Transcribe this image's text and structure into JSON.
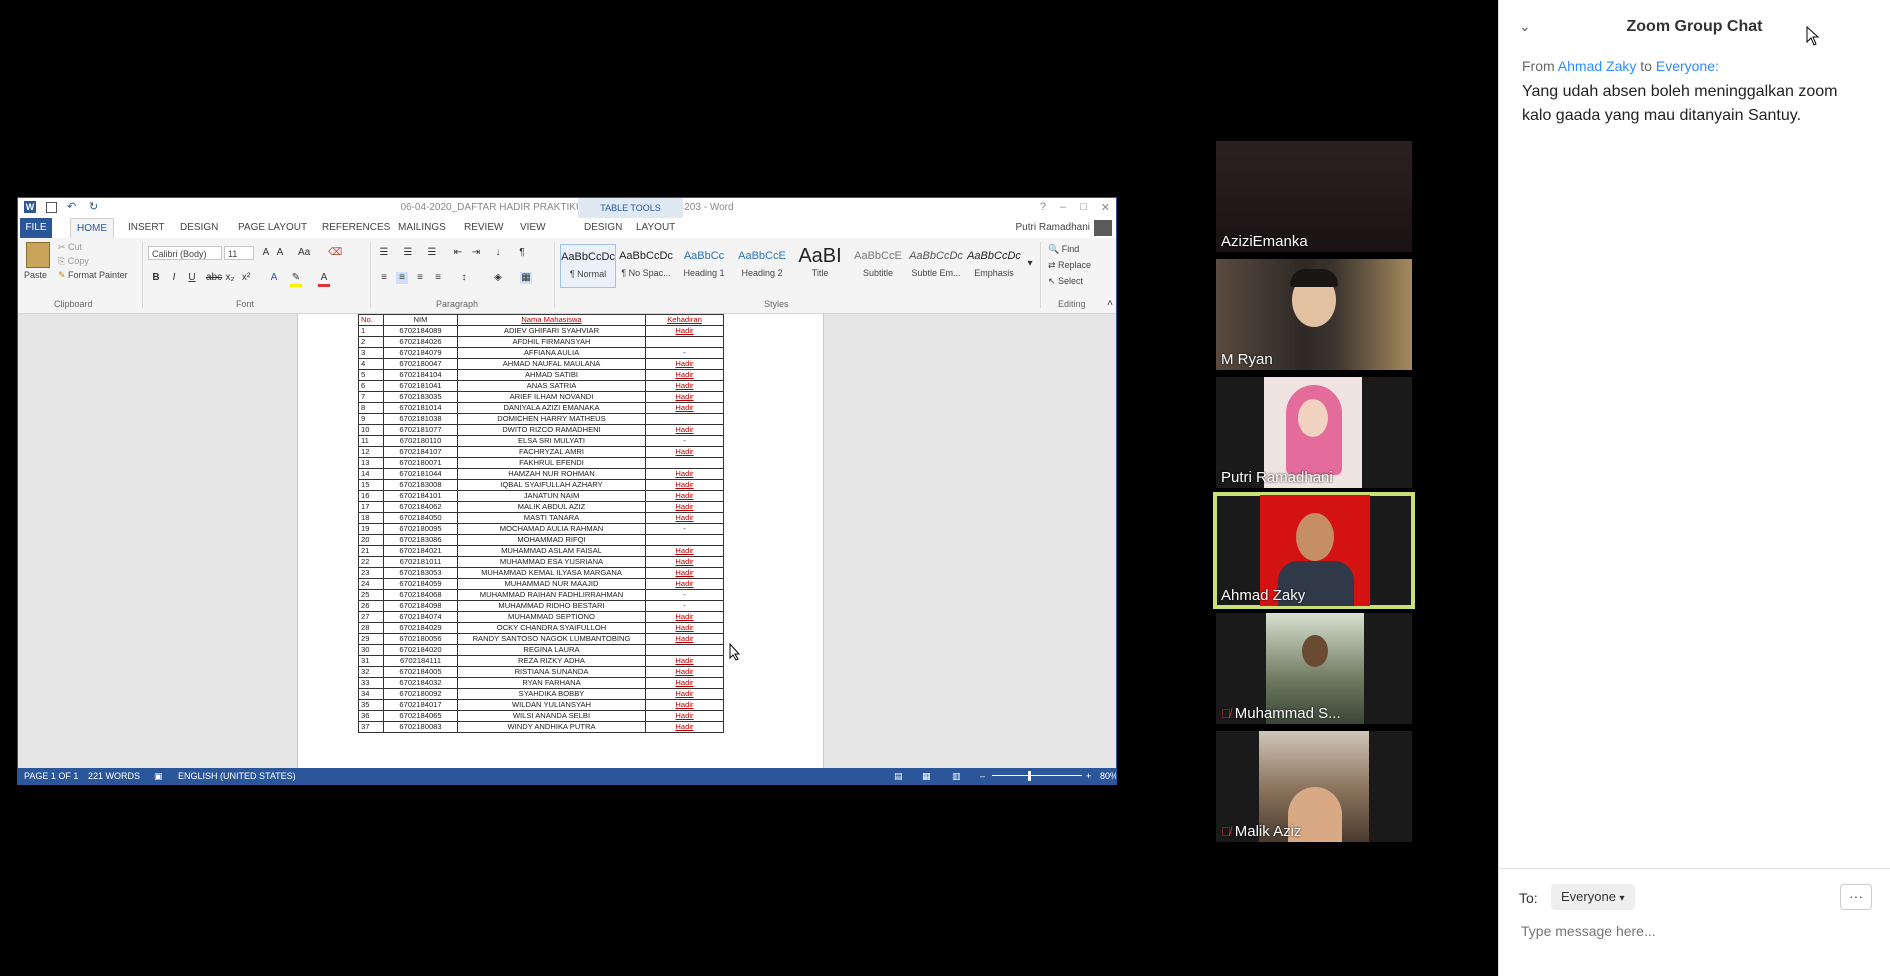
{
  "word": {
    "title": "06-04-2020_DAFTAR HADIR PRAKTIKUM INTERFACE D3TK4203 - Word",
    "table_tools": "TABLE TOOLS",
    "user": "Putri Ramadhani",
    "tabs": [
      "FILE",
      "HOME",
      "INSERT",
      "DESIGN",
      "PAGE LAYOUT",
      "REFERENCES",
      "MAILINGS",
      "REVIEW",
      "VIEW",
      "DESIGN",
      "LAYOUT"
    ],
    "clipboard": {
      "paste": "Paste",
      "cut": "Cut",
      "copy": "Copy",
      "format_painter": "Format Painter",
      "label": "Clipboard"
    },
    "font": {
      "name": "Calibri (Body)",
      "size": "11",
      "label": "Font"
    },
    "paragraph_label": "Paragraph",
    "styles": [
      {
        "preview": "AaBbCcDc",
        "name": "¶ Normal"
      },
      {
        "preview": "AaBbCcDc",
        "name": "¶ No Spac..."
      },
      {
        "preview": "AaBbCc",
        "name": "Heading 1"
      },
      {
        "preview": "AaBbCcE",
        "name": "Heading 2"
      },
      {
        "preview": "AaBI",
        "name": "Title"
      },
      {
        "preview": "AaBbCcE",
        "name": "Subtitle"
      },
      {
        "preview": "AaBbCcDc",
        "name": "Subtle Em..."
      },
      {
        "preview": "AaBbCcDc",
        "name": "Emphasis"
      }
    ],
    "styles_label": "Styles",
    "editing": {
      "find": "Find",
      "replace": "Replace",
      "select": "Select",
      "label": "Editing"
    },
    "table_headers": [
      "No.",
      "NIM",
      "Nama Mahasiswa",
      "Kehadiran"
    ],
    "rows": [
      [
        "1",
        "6702184089",
        "ADIEV GHIFARI SYAHVIAR",
        "Hadir"
      ],
      [
        "2",
        "6702184026",
        "AFDHIL FIRMANSYAH",
        ""
      ],
      [
        "3",
        "6702184079",
        "AFFIANA AULIA",
        "-"
      ],
      [
        "4",
        "6702180047",
        "AHMAD NAUFAL MAULANA",
        "Hadir"
      ],
      [
        "5",
        "6702184104",
        "AHMAD SATIBI",
        "Hadir"
      ],
      [
        "6",
        "6702181041",
        "ANAS SATRIA",
        "Hadir"
      ],
      [
        "7",
        "6702183035",
        "ARIEF ILHAM NOVANDI",
        "Hadir"
      ],
      [
        "8",
        "6702181014",
        "DANIYALA AZIZI EMANAKA",
        "Hadir"
      ],
      [
        "9",
        "6702181038",
        "DOMICHEN HARRY MATHEUS",
        ""
      ],
      [
        "10",
        "6702181077",
        "DWITO RIZCO RAMADHENI",
        "Hadir"
      ],
      [
        "11",
        "6702180110",
        "ELSA SRI MULYATI",
        "-"
      ],
      [
        "12",
        "6702184107",
        "FACHRYZAL AMRI",
        "Hadir"
      ],
      [
        "13",
        "6702180071",
        "FAKHRUL EFENDI",
        ""
      ],
      [
        "14",
        "6702181044",
        "HAMZAH NUR ROHMAN",
        "Hadir"
      ],
      [
        "15",
        "6702183008",
        "IQBAL SYAIFULLAH AZHARY",
        "Hadir"
      ],
      [
        "16",
        "6702184101",
        "JANATUN NAIM",
        "Hadir"
      ],
      [
        "17",
        "6702184062",
        "MALIK ABDUL AZIZ",
        "Hadir"
      ],
      [
        "18",
        "6702184050",
        "MASTI TANARA",
        "Hadir"
      ],
      [
        "19",
        "6702180095",
        "MOCHAMAD AULIA RAHMAN",
        "-"
      ],
      [
        "20",
        "6702183086",
        "MOHAMMAD RIFQI",
        ""
      ],
      [
        "21",
        "6702184021",
        "MUHAMMAD ASLAM FAISAL",
        "Hadir"
      ],
      [
        "22",
        "6702181011",
        "MUHAMMAD ESA YUSRIANA",
        "Hadir"
      ],
      [
        "23",
        "6702183053",
        "MUHAMMAD KEMAL ILYASA MARGANA",
        "Hadir"
      ],
      [
        "24",
        "6702184059",
        "MUHAMMAD NUR MAAJID",
        "Hadir"
      ],
      [
        "25",
        "6702184068",
        "MUHAMMAD RAIHAN FADHLIRRAHMAN",
        "-"
      ],
      [
        "26",
        "6702184098",
        "MUHAMMAD RIDHO BESTARI",
        "-"
      ],
      [
        "27",
        "6702184074",
        "MUHAMMAD SEPTIONO",
        "Hadir"
      ],
      [
        "28",
        "6702184029",
        "OCKY CHANDRA SYAIFULLOH",
        "Hadir"
      ],
      [
        "29",
        "6702180056",
        "RANDY SANTOSO NAGOK LUMBANTOBING",
        "Hadir"
      ],
      [
        "30",
        "6702184020",
        "REGINA LAURA",
        ""
      ],
      [
        "31",
        "6702184111",
        "REZA RIZKY ADHA",
        "Hadir"
      ],
      [
        "32",
        "6702184005",
        "RISTIANA SUNANDA",
        "Hadir"
      ],
      [
        "33",
        "6702184032",
        "RYAN FARHANA",
        "Hadir"
      ],
      [
        "34",
        "6702180092",
        "SYAHDIKA BOBBY",
        "Hadir"
      ],
      [
        "35",
        "6702184017",
        "WILDAN YULIANSYAH",
        "Hadir"
      ],
      [
        "36",
        "6702184065",
        "WILSI ANANDA SELBI",
        "Hadir"
      ],
      [
        "37",
        "6702180083",
        "WINDY ANDHIKA PUTRA",
        "Hadir"
      ]
    ],
    "status": {
      "page": "PAGE 1 OF 1",
      "words": "221 WORDS",
      "language": "ENGLISH (UNITED STATES)",
      "zoom": "80%"
    }
  },
  "participants": [
    {
      "name": "AziziEmanka",
      "muted": false,
      "active": false,
      "bg": "#2a1d1f"
    },
    {
      "name": "M Ryan",
      "muted": false,
      "active": false,
      "bg": "#3d3430"
    },
    {
      "name": "Putri Ramadhani",
      "muted": false,
      "active": false,
      "bg": "#e9d7d4"
    },
    {
      "name": "Ahmad Zaky",
      "muted": false,
      "active": true,
      "bg": "#d41212"
    },
    {
      "name": "Muhammad S...",
      "muted": true,
      "active": false,
      "bg": "#3a4636"
    },
    {
      "name": "Malik Aziz",
      "muted": true,
      "active": false,
      "bg": "#6b5a4a"
    }
  ],
  "chat": {
    "title": "Zoom Group Chat",
    "from_label": "From",
    "sender": "Ahmad Zaky",
    "to_label": "to",
    "recipient": "Everyone:",
    "message": "Yang udah absen boleh meninggalkan zoom kalo gaada yang mau ditanyain Santuy.",
    "to_prefix": "To:",
    "to_value": "Everyone",
    "input_placeholder": "Type message here...",
    "more": "···"
  }
}
